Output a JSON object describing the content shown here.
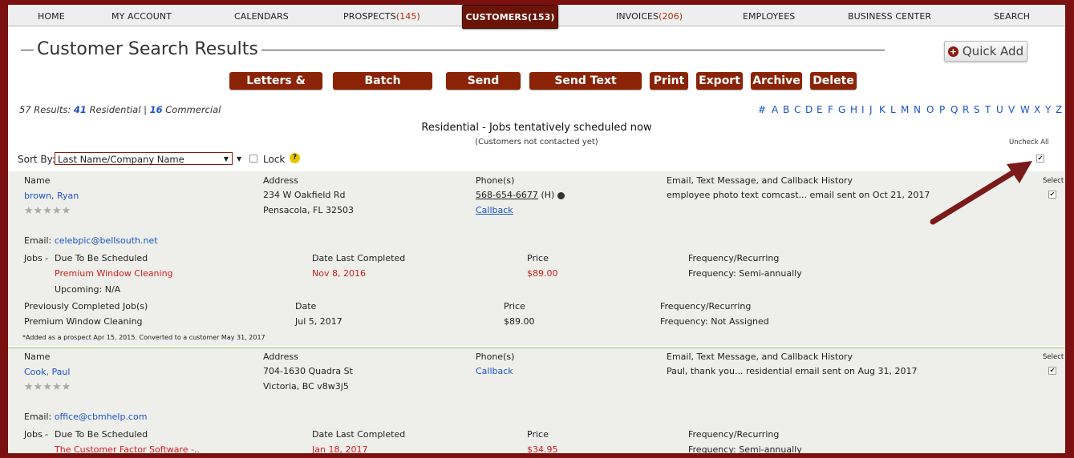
{
  "nav": [
    {
      "label": "HOME"
    },
    {
      "label": "MY ACCOUNT"
    },
    {
      "label": "CALENDARS"
    },
    {
      "label": "PROSPECTS",
      "count": "(145)"
    },
    {
      "label": "CUSTOMERS",
      "count": "(153)",
      "active": true
    },
    {
      "label": "INVOICES",
      "count": "(206)"
    },
    {
      "label": "EMPLOYEES"
    },
    {
      "label": "BUSINESS CENTER"
    },
    {
      "label": "SEARCH"
    }
  ],
  "page_title": "Customer Search Results",
  "quick_add_label": "Quick Add",
  "actions": [
    "Letters & Labels",
    "Batch Scheduling",
    "Send Emails",
    "Send Text Messages",
    "Print",
    "Export",
    "Archive",
    "Delete"
  ],
  "results": {
    "prefix": "57 Results:",
    "residential_count": "41",
    "residential_label": "Residential",
    "sep": "|",
    "commercial_count": "16",
    "commercial_label": "Commercial"
  },
  "alphabet": [
    "#",
    "A",
    "B",
    "C",
    "D",
    "E",
    "F",
    "G",
    "H",
    "I",
    "J",
    "K",
    "L",
    "M",
    "N",
    "O",
    "P",
    "Q",
    "R",
    "S",
    "T",
    "U",
    "V",
    "W",
    "X",
    "Y",
    "Z"
  ],
  "section": {
    "title": "Residential - Jobs tentatively scheduled now",
    "subtitle": "(Customers not contacted yet)"
  },
  "uncheck_all_label": "Uncheck All",
  "sort": {
    "label": "Sort By:",
    "value": "Last Name/Company Name",
    "lock_label": "Lock"
  },
  "column_headers": {
    "name": "Name",
    "address": "Address",
    "phones": "Phone(s)",
    "history": "Email, Text Message, and Callback History",
    "select": "Select"
  },
  "job_headers": {
    "jobs": "Jobs -",
    "due": "Due To Be Scheduled",
    "last": "Date Last Completed",
    "price": "Price",
    "freq": "Frequency/Recurring",
    "prev": "Previously Completed Job(s)",
    "date": "Date",
    "upcoming": "Upcoming:"
  },
  "customers": [
    {
      "name": "brown, Ryan",
      "address1": "234 W Oakfield Rd",
      "address2": "Pensacola, FL 32503",
      "phone": "568-654-6677",
      "phone_type": "(H)",
      "callback": "Callback",
      "history": "employee photo text comcast... email sent on Oct 21, 2017",
      "email_label": "Email:",
      "email": "celebpic@bellsouth.net",
      "due_job": "Premium Window Cleaning",
      "due_last": "Nov 8, 2016",
      "due_price": "$89.00",
      "due_freq": "Frequency: Semi-annually",
      "upcoming": "N/A",
      "prev_job": "Premium Window Cleaning",
      "prev_date": "Jul 5, 2017",
      "prev_price": "$89.00",
      "prev_freq": "Frequency: Not Assigned",
      "note": "*Added as a prospect Apr 15, 2015. Converted to a customer May 31, 2017"
    },
    {
      "name": "Cook, Paul",
      "address1": "704-1630 Quadra St",
      "address2": "Victoria, BC v8w3j5",
      "callback": "Callback",
      "history": "Paul, thank you... residential email sent on Aug 31, 2017",
      "email_label": "Email:",
      "email": "office@cbmhelp.com",
      "due_job": "The Customer Factor Software -..",
      "due_last": "Jan 18, 2017",
      "due_price": "$34.95",
      "due_freq": "Frequency: Semi-annually"
    }
  ],
  "stars_text": "★★★★★",
  "colors": {
    "accent": "#8b2306",
    "frame": "#7a1010",
    "link": "#1a55c8",
    "warning": "#d02020"
  }
}
